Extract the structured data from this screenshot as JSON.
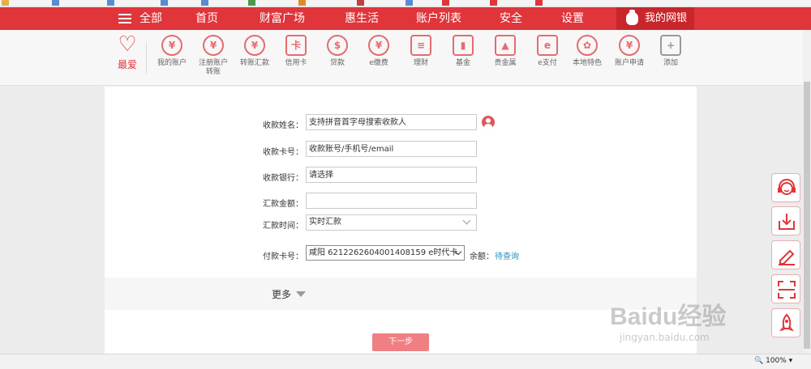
{
  "browser": {
    "bookmarks": [
      "",
      "",
      "",
      "",
      "",
      "",
      "",
      "",
      "",
      "",
      "",
      ""
    ],
    "zoom": "100%"
  },
  "top_nav": {
    "all": "全部",
    "items": [
      "首页",
      "财富广场",
      "惠生活",
      "账户列表",
      "安全",
      "设置"
    ],
    "my_bank": "我的网银"
  },
  "icon_menu": {
    "favorite": "最爱",
    "items": [
      {
        "label": "我的账户",
        "icon": "yuan-circle-icon",
        "glyph": "¥"
      },
      {
        "label": "注册账户转账",
        "icon": "yuan-transfer-icon",
        "glyph": "¥"
      },
      {
        "label": "转账汇款",
        "icon": "yuan-remit-icon",
        "glyph": "¥"
      },
      {
        "label": "信用卡",
        "icon": "credit-card-icon",
        "glyph": "卡"
      },
      {
        "label": "贷款",
        "icon": "money-bag-icon",
        "glyph": "$"
      },
      {
        "label": "e缴费",
        "icon": "water-drop-icon",
        "glyph": "¥"
      },
      {
        "label": "理财",
        "icon": "abacus-icon",
        "glyph": "≡"
      },
      {
        "label": "基金",
        "icon": "bar-chart-icon",
        "glyph": "▮"
      },
      {
        "label": "贵金属",
        "icon": "gold-bars-icon",
        "glyph": "▲"
      },
      {
        "label": "e支付",
        "icon": "e-pay-icon",
        "glyph": "e"
      },
      {
        "label": "本地特色",
        "icon": "film-reel-icon",
        "glyph": "✿"
      },
      {
        "label": "账户申请",
        "icon": "yuan-apply-icon",
        "glyph": "¥"
      },
      {
        "label": "添加",
        "icon": "plus-square-icon",
        "glyph": "+"
      }
    ]
  },
  "form": {
    "payee_name_label": "收款姓名：",
    "payee_name_placeholder": "支持拼音首字母搜索收款人",
    "payee_account_label": "收款卡号：",
    "payee_account_placeholder": "收款账号/手机号/email",
    "payee_bank_label": "收款银行：",
    "payee_bank_placeholder": "请选择",
    "amount_label": "汇款金额：",
    "amount_value": "",
    "time_label": "汇款时间：",
    "time_value": "实时汇款",
    "payer_card_label": "付款卡号：",
    "payer_card_value": "咸阳 6212262604001408159 e时代卡",
    "balance_label": "余额：",
    "balance_query": "待查询",
    "more": "更多",
    "next_button": "下一步"
  },
  "side_tools": [
    "customer-service-icon",
    "download-icon",
    "edit-icon",
    "scan-icon",
    "rocket-icon"
  ],
  "watermark": {
    "brand": "Baidu经验",
    "url": "jingyan.baidu.com"
  },
  "colors": {
    "brand_red": "#e0353b",
    "dark_red": "#c9262c",
    "icon_red": "#e56b6f",
    "link_blue": "#2a8fbd",
    "button_pink": "#ef7f83"
  }
}
